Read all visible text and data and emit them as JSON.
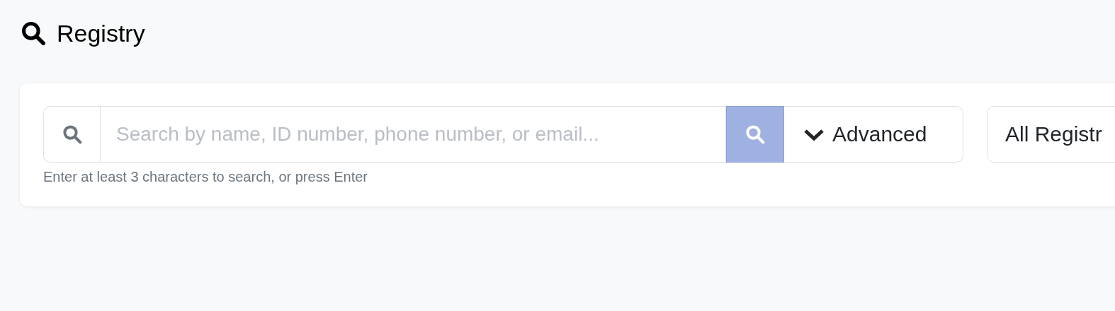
{
  "page": {
    "title": "Registry"
  },
  "search": {
    "placeholder": "Search by name, ID number, phone number, or email...",
    "hint": "Enter at least 3 characters to search, or press Enter"
  },
  "advanced_button": {
    "label": "Advanced",
    "expanded": false
  },
  "registry_select": {
    "value": "All Registr"
  }
}
